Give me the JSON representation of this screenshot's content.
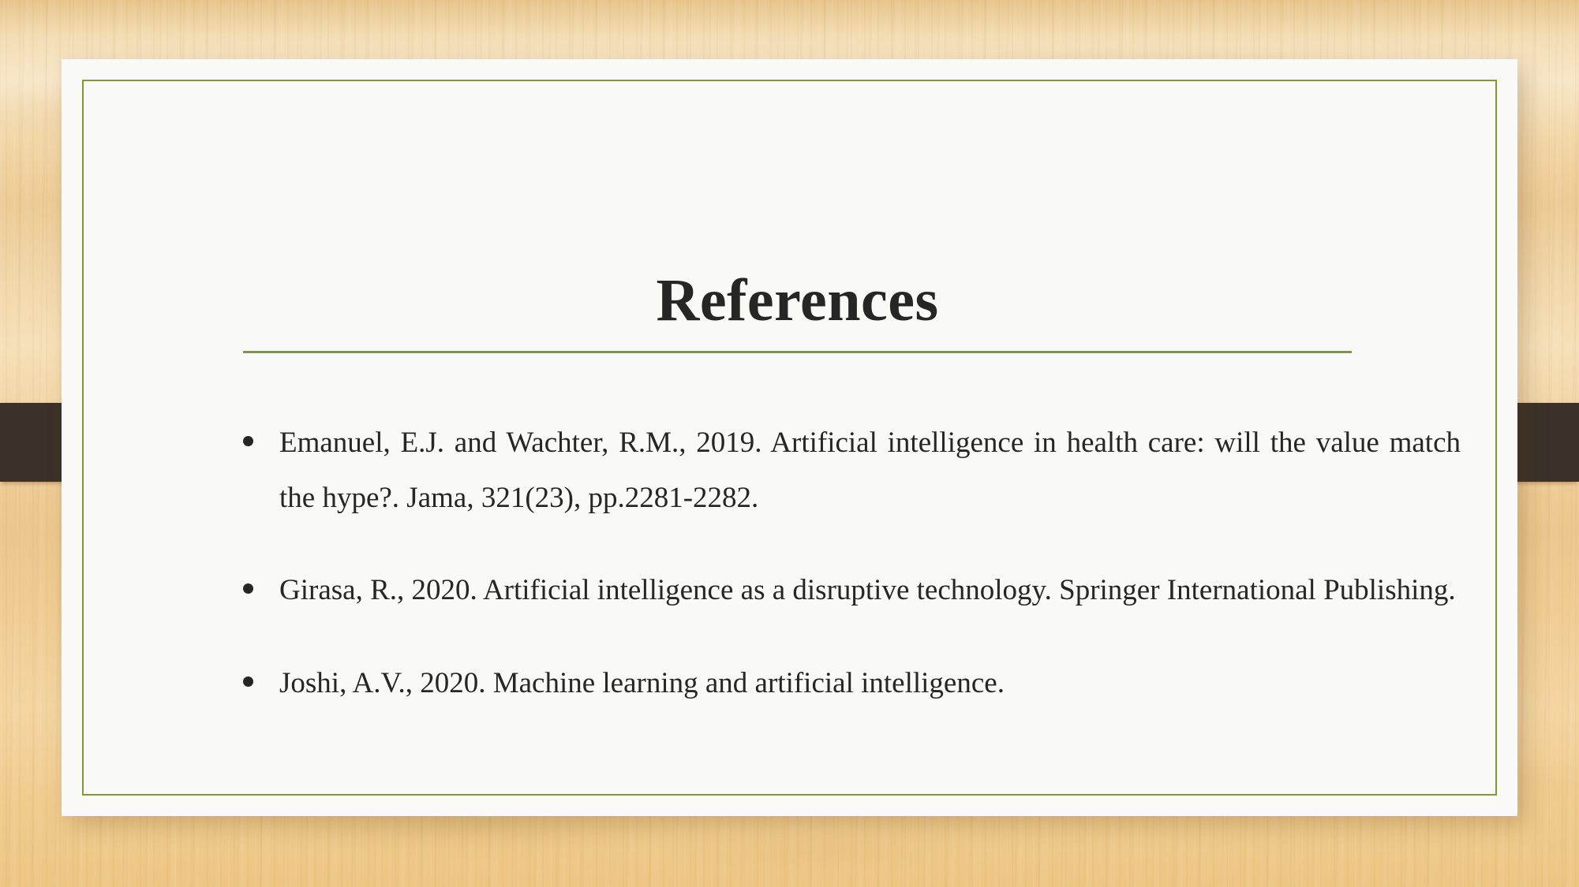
{
  "slide": {
    "title": "References",
    "background_color": "#f0cd95",
    "card_color": "#f9f9f8",
    "accent_color": "#7d9a33",
    "ribbon_color": "#3a3128",
    "text_color": "#262626"
  },
  "references": [
    {
      "bullet": "•",
      "text": "Emanuel, E.J. and Wachter, R.M., 2019. Artificial intelligence in health care: will the value match the hype?. Jama, 321(23), pp.2281-2282."
    },
    {
      "bullet": "•",
      "text": "Girasa, R., 2020. Artificial intelligence as a disruptive technology. Springer International Publishing."
    },
    {
      "bullet": "•",
      "text": "Joshi, A.V., 2020. Machine learning and artificial intelligence."
    }
  ]
}
